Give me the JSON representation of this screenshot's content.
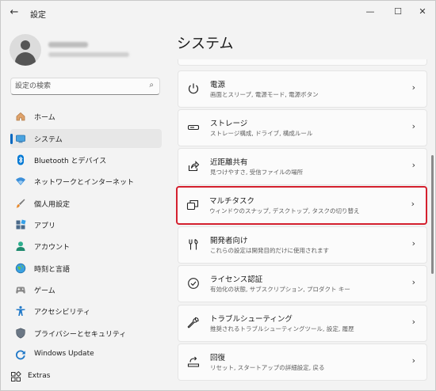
{
  "titlebar": {
    "back_icon": "arrow-left-icon",
    "title": "設定",
    "minimize": "—",
    "maximize": "☐",
    "close": "✕"
  },
  "profile": {
    "avatar_icon": "user-avatar-icon"
  },
  "search": {
    "placeholder": "設定の検索",
    "value": "",
    "icon": "search-icon"
  },
  "nav": {
    "items": [
      {
        "label": "ホーム",
        "icon": "home-icon"
      },
      {
        "label": "システム",
        "icon": "system-icon",
        "selected": true
      },
      {
        "label": "Bluetooth とデバイス",
        "icon": "bluetooth-icon"
      },
      {
        "label": "ネットワークとインターネット",
        "icon": "network-icon"
      },
      {
        "label": "個人用設定",
        "icon": "brush-icon"
      },
      {
        "label": "アプリ",
        "icon": "apps-icon"
      },
      {
        "label": "アカウント",
        "icon": "account-icon"
      },
      {
        "label": "時刻と言語",
        "icon": "globe-icon"
      },
      {
        "label": "ゲーム",
        "icon": "game-icon"
      },
      {
        "label": "アクセシビリティ",
        "icon": "accessibility-icon"
      },
      {
        "label": "プライバシーとセキュリティ",
        "icon": "shield-icon"
      },
      {
        "label": "Windows Update",
        "icon": "update-icon"
      },
      {
        "label": "Extras",
        "icon": "extras-icon"
      }
    ]
  },
  "main": {
    "title": "システム",
    "cards": [
      {
        "title": "電源",
        "subtitle": "画面とスリープ, 電源モード, 電源ボタン",
        "icon": "power-icon"
      },
      {
        "title": "ストレージ",
        "subtitle": "ストレージ構成, ドライブ, 構成ルール",
        "icon": "storage-icon"
      },
      {
        "title": "近距離共有",
        "subtitle": "見つけやすさ, 受信ファイルの場所",
        "icon": "share-icon"
      },
      {
        "title": "マルチタスク",
        "subtitle": "ウィンドウのスナップ, デスクトップ, タスクの切り替え",
        "icon": "multitask-icon",
        "highlighted": true
      },
      {
        "title": "開発者向け",
        "subtitle": "これらの設定は開発目的だけに使用されます",
        "icon": "developer-icon"
      },
      {
        "title": "ライセンス認証",
        "subtitle": "有効化の状態, サブスクリプション, プロダクト キー",
        "icon": "activation-icon"
      },
      {
        "title": "トラブルシューティング",
        "subtitle": "推奨されるトラブルシューティングツール, 設定, 履歴",
        "icon": "wrench-icon"
      },
      {
        "title": "回復",
        "subtitle": "リセット, スタートアップの詳細設定, 戻る",
        "icon": "recovery-icon"
      }
    ]
  },
  "colors": {
    "accent": "#0067c0",
    "highlight": "#d4202e",
    "background": "#f3f3f3",
    "card": "#fbfbfb"
  }
}
